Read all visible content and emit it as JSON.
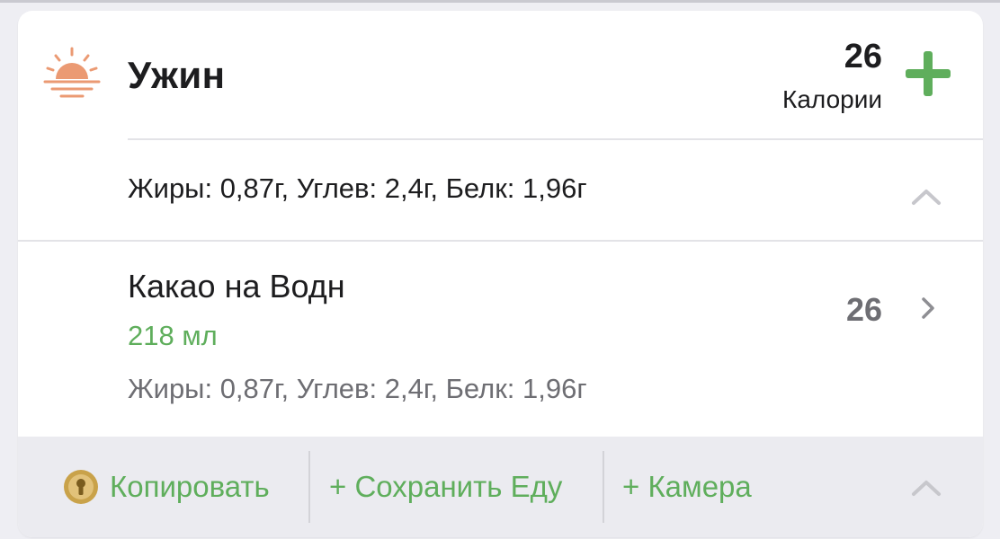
{
  "meal": {
    "title": "Ужин",
    "calories_value": "26",
    "calories_label": "Калории"
  },
  "summary": {
    "macros": "Жиры: 0,87г, Углев: 2,4г, Белк: 1,96г"
  },
  "food_items": [
    {
      "name": "Какао на Водн",
      "amount": "218 мл",
      "macros": "Жиры: 0,87г, Углев: 2,4г, Белк: 1,96г",
      "calories": "26"
    }
  ],
  "footer": {
    "copy_label": "Копировать",
    "save_food_label": "+ Сохранить Еду",
    "camera_label": "+ Камера"
  },
  "icons": {
    "meal_icon": "sunset-icon",
    "add_icon": "plus-icon",
    "collapse_icon": "chevron-up-icon",
    "open_icon": "chevron-right-icon",
    "premium_icon": "keyhole-badge-icon"
  },
  "colors": {
    "accent_green": "#5fae5c",
    "sunset_orange": "#eb9a73",
    "badge_gold": "#c9a24a"
  }
}
